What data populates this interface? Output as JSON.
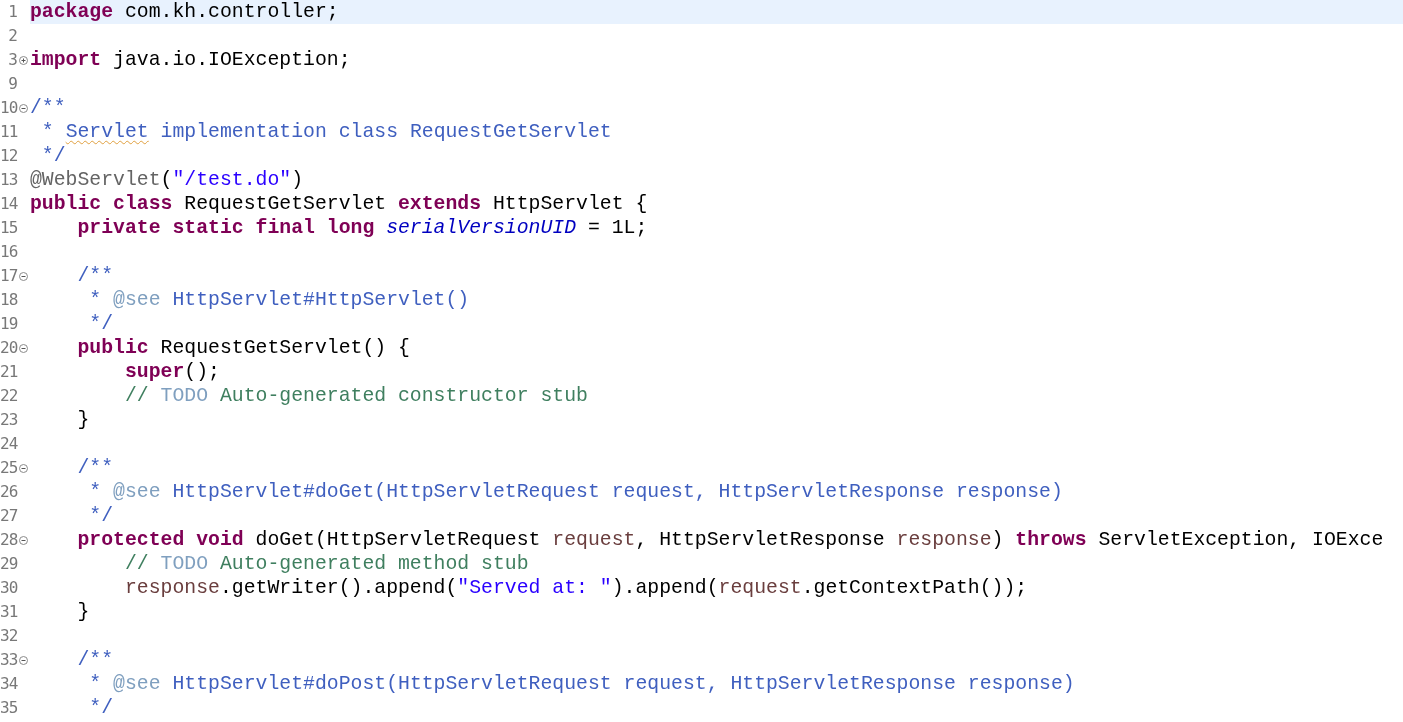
{
  "editor": {
    "lines": [
      {
        "number": "1",
        "current": true,
        "tokens": [
          {
            "kind": "kw",
            "text": "package"
          },
          {
            "kind": "plain",
            "text": " com.kh.controller;"
          }
        ]
      },
      {
        "number": "2",
        "current": false
      },
      {
        "number": "3",
        "collapsed": true,
        "current": false,
        "tokens": [
          {
            "kind": "kw",
            "text": "import"
          },
          {
            "kind": "plain",
            "text": " java.io.IOException;"
          }
        ]
      },
      {
        "number": "9",
        "current": false
      },
      {
        "number": "10",
        "collapsed": false,
        "current": false,
        "tokens": [
          {
            "kind": "doc",
            "text": "/**"
          }
        ]
      },
      {
        "number": "11",
        "current": false,
        "tokens": [
          {
            "kind": "doc",
            "text": " * "
          },
          {
            "kind": "misspell",
            "text": "Servlet"
          },
          {
            "kind": "doc",
            "text": " implementation class RequestGetServlet"
          }
        ]
      },
      {
        "number": "12",
        "current": false,
        "tokens": [
          {
            "kind": "doc",
            "text": " */"
          }
        ]
      },
      {
        "number": "13",
        "current": false,
        "tokens": [
          {
            "kind": "ann",
            "text": "@WebServlet"
          },
          {
            "kind": "plain",
            "text": "("
          },
          {
            "kind": "str",
            "text": "\"/test.do\""
          },
          {
            "kind": "plain",
            "text": ")"
          }
        ]
      },
      {
        "number": "14",
        "current": false,
        "tokens": [
          {
            "kind": "kw",
            "text": "public class"
          },
          {
            "kind": "plain",
            "text": " RequestGetServlet "
          },
          {
            "kind": "kw",
            "text": "extends"
          },
          {
            "kind": "plain",
            "text": " HttpServlet {"
          }
        ]
      },
      {
        "number": "15",
        "current": false,
        "tokens": [
          {
            "kind": "kw",
            "text": "    private static final long "
          },
          {
            "kind": "field",
            "text": "serialVersionUID"
          },
          {
            "kind": "plain",
            "text": " = 1L;"
          }
        ]
      },
      {
        "number": "16",
        "current": false
      },
      {
        "number": "17",
        "collapsed": false,
        "current": false,
        "tokens": [
          {
            "kind": "doc",
            "text": "    /**"
          }
        ]
      },
      {
        "number": "18",
        "current": false,
        "tokens": [
          {
            "kind": "doc",
            "text": "     * "
          },
          {
            "kind": "doctag",
            "text": "@see"
          },
          {
            "kind": "doc",
            "text": " HttpServlet#HttpServlet()"
          }
        ]
      },
      {
        "number": "19",
        "current": false,
        "tokens": [
          {
            "kind": "doc",
            "text": "     */"
          }
        ]
      },
      {
        "number": "20",
        "collapsed": false,
        "current": false,
        "tokens": [
          {
            "kind": "kw",
            "text": "    public"
          },
          {
            "kind": "plain",
            "text": " RequestGetServlet() {"
          }
        ]
      },
      {
        "number": "21",
        "current": false,
        "tokens": [
          {
            "kind": "kw",
            "text": "        super"
          },
          {
            "kind": "plain",
            "text": "();"
          }
        ]
      },
      {
        "number": "22",
        "current": false,
        "tokens": [
          {
            "kind": "comment",
            "text": "        // "
          },
          {
            "kind": "todo",
            "text": "TODO"
          },
          {
            "kind": "comment",
            "text": " Auto-generated constructor stub"
          }
        ]
      },
      {
        "number": "23",
        "current": false,
        "tokens": [
          {
            "kind": "plain",
            "text": "    }"
          }
        ]
      },
      {
        "number": "24",
        "current": false
      },
      {
        "number": "25",
        "collapsed": false,
        "current": false,
        "tokens": [
          {
            "kind": "doc",
            "text": "    /**"
          }
        ]
      },
      {
        "number": "26",
        "current": false,
        "tokens": [
          {
            "kind": "doc",
            "text": "     * "
          },
          {
            "kind": "doctag",
            "text": "@see"
          },
          {
            "kind": "doc",
            "text": " HttpServlet#doGet(HttpServletRequest request, HttpServletResponse response)"
          }
        ]
      },
      {
        "number": "27",
        "current": false,
        "tokens": [
          {
            "kind": "doc",
            "text": "     */"
          }
        ]
      },
      {
        "number": "28",
        "collapsed": false,
        "current": false,
        "tokens": [
          {
            "kind": "kw",
            "text": "    protected void"
          },
          {
            "kind": "plain",
            "text": " doGet(HttpServletRequest "
          },
          {
            "kind": "param",
            "text": "request"
          },
          {
            "kind": "plain",
            "text": ", HttpServletResponse "
          },
          {
            "kind": "param",
            "text": "response"
          },
          {
            "kind": "plain",
            "text": ") "
          },
          {
            "kind": "kw",
            "text": "throws"
          },
          {
            "kind": "plain",
            "text": " ServletException, IOExce"
          }
        ]
      },
      {
        "number": "29",
        "current": false,
        "tokens": [
          {
            "kind": "comment",
            "text": "        // "
          },
          {
            "kind": "todo",
            "text": "TODO"
          },
          {
            "kind": "comment",
            "text": " Auto-generated method stub"
          }
        ]
      },
      {
        "number": "30",
        "current": false,
        "tokens": [
          {
            "kind": "param",
            "text": "        response"
          },
          {
            "kind": "plain",
            "text": ".getWriter().append("
          },
          {
            "kind": "str",
            "text": "\"Served at: \""
          },
          {
            "kind": "plain",
            "text": ").append("
          },
          {
            "kind": "param",
            "text": "request"
          },
          {
            "kind": "plain",
            "text": ".getContextPath());"
          }
        ]
      },
      {
        "number": "31",
        "current": false,
        "tokens": [
          {
            "kind": "plain",
            "text": "    }"
          }
        ]
      },
      {
        "number": "32",
        "current": false
      },
      {
        "number": "33",
        "collapsed": false,
        "current": false,
        "tokens": [
          {
            "kind": "doc",
            "text": "    /**"
          }
        ]
      },
      {
        "number": "34",
        "current": false,
        "tokens": [
          {
            "kind": "doc",
            "text": "     * "
          },
          {
            "kind": "doctag",
            "text": "@see"
          },
          {
            "kind": "doc",
            "text": " HttpServlet#doPost(HttpServletRequest request, HttpServletResponse response)"
          }
        ]
      },
      {
        "number": "35",
        "current": false,
        "tokens": [
          {
            "kind": "doc",
            "text": "     */"
          }
        ]
      }
    ]
  }
}
